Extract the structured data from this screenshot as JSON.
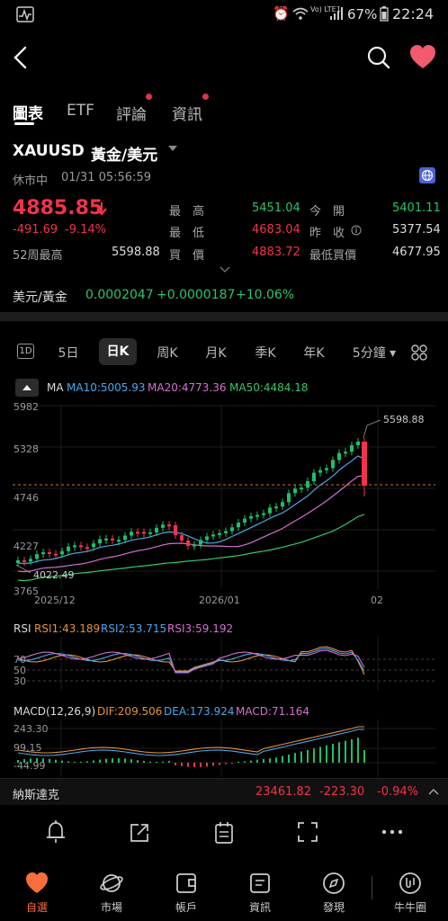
{
  "status_bar": {
    "battery": "67%",
    "time": "22:24",
    "network": "Vo) LTE1"
  },
  "tabs": [
    {
      "label": "圖表",
      "active": true,
      "dot": false
    },
    {
      "label": "ETF",
      "active": false,
      "dot": false
    },
    {
      "label": "評論",
      "active": false,
      "dot": true
    },
    {
      "label": "資訊",
      "active": false,
      "dot": true
    }
  ],
  "instrument": {
    "symbol": "XAUUSD",
    "name": "黃金/美元",
    "market_state": "休市中",
    "datetime": "01/31 05:56:59"
  },
  "quote": {
    "price": "4885.85",
    "change": "-491.69",
    "change_pct": "-9.14%",
    "week52_high_label": "52周最高",
    "week52_high": "5598.88",
    "high_label": "最　高",
    "high": "5451.04",
    "open_label": "今　開",
    "open": "5401.11",
    "low_label": "最　低",
    "low": "4683.04",
    "prev_close_label": "昨　收",
    "prev_close": "5377.54",
    "bid_label": "買　價",
    "bid": "4883.72",
    "min_bid_label": "最低買價",
    "min_bid": "4677.95"
  },
  "cross": {
    "label": "美元/黃金",
    "value": "0.0002047",
    "change": "+0.0000187",
    "pct": "+10.06%"
  },
  "periods": [
    {
      "label": "1D",
      "boxed": true
    },
    {
      "label": "5日"
    },
    {
      "label": "日K",
      "active": true
    },
    {
      "label": "周K"
    },
    {
      "label": "月K"
    },
    {
      "label": "季K"
    },
    {
      "label": "年K"
    },
    {
      "label": "5分鐘 ▾"
    }
  ],
  "ma_legend": {
    "ma": "MA",
    "ma10": "MA10:5005.93",
    "ma20": "MA20:4773.36",
    "ma50": "MA50:4484.18"
  },
  "main_chart": {
    "y_ticks": [
      "5982",
      "5328",
      "4746",
      "4227",
      "3765"
    ],
    "x_ticks": [
      "2025/12",
      "2026/01",
      "02"
    ],
    "max_label": "5598.88",
    "min_label": "4022.49",
    "colors": {
      "up": "#1fbf6a",
      "down": "#f2334b",
      "ma10": "#4aa8e8",
      "ma20": "#d66fd0",
      "ma50": "#35c76a"
    }
  },
  "rsi": {
    "title": "RSI",
    "rsi1": "RSI1:43.189",
    "rsi2": "RSI2:53.715",
    "rsi3": "RSI3:59.192",
    "levels": [
      "70",
      "50",
      "30"
    ]
  },
  "macd": {
    "title": "MACD(12,26,9)",
    "dif": "DIF:209.506",
    "dea": "DEA:173.924",
    "macd": "MACD:71.164",
    "y_ticks": [
      "243.30",
      "99.15",
      "-44.99"
    ]
  },
  "ticker": {
    "name": "納斯達克",
    "value": "23461.82",
    "change": "-223.30",
    "pct": "-0.94%"
  },
  "bottom_nav": [
    {
      "label": "自選",
      "icon": "heart-icon",
      "active": true
    },
    {
      "label": "市場",
      "icon": "planet-icon"
    },
    {
      "label": "帳戶",
      "icon": "wallet-icon"
    },
    {
      "label": "資訊",
      "icon": "news-icon"
    },
    {
      "label": "發現",
      "icon": "compass-icon"
    },
    {
      "label": "牛牛圈",
      "icon": "bull-circle-icon"
    }
  ]
}
